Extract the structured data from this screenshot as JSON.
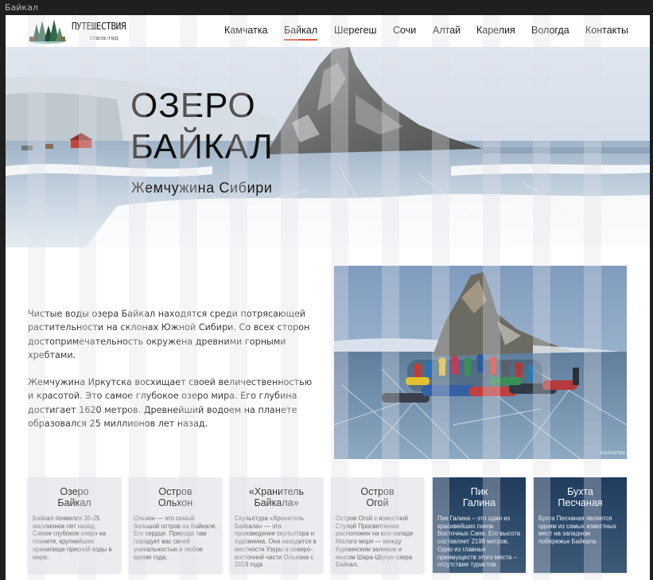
{
  "window": {
    "title": "Байкал"
  },
  "logo": {
    "title": "ПУТЕШЕСТВИЯ",
    "subtitle": "стиль-гид"
  },
  "nav": {
    "items": [
      {
        "label": "Камчатка"
      },
      {
        "label": "Байкал",
        "active": true
      },
      {
        "label": "Шерегеш"
      },
      {
        "label": "Сочи"
      },
      {
        "label": "Алтай"
      },
      {
        "label": "Карелия"
      },
      {
        "label": "Вологда"
      },
      {
        "label": "Контакты"
      }
    ],
    "active_color": "#e2553d"
  },
  "hero": {
    "title_line1": "ОЗЕРО",
    "title_line2": "БАЙКАЛ",
    "subtitle": "Жемчужина Сибири"
  },
  "intro": {
    "paragraph1": "Чистые воды озера Байкал находятся среди потрясающей растительности на склонах Южной Сибири. Со всех сторон достопримечательность окружена древними горными хребтами.",
    "paragraph2": "Жемчужина Иркутска восхищает своей величественностью и красотой. Это самое глубокое озеро мира. Его глубина достигает 1620 метров. Древнейший водоем на планете образовался 25 миллионов лет назад."
  },
  "photo": {
    "credit": "YOUSISTER"
  },
  "cards": [
    {
      "title_line1": "Озеро",
      "title_line2": "Байкал",
      "text": "Байкал появился 35-25 миллионов лет назад. Самое глубокое озеро на планете, крупнейшее хранилище пресной воды в мире.",
      "style": "light"
    },
    {
      "title_line1": "Остров",
      "title_line2": "Ольхон",
      "text": "Ольхон — это самый большой остров на Байкале. Его сердце. Природа там порадует вас своей уникальностью в любое время года.",
      "style": "light"
    },
    {
      "title_line1": "«Хранитель",
      "title_line2": "Байкала»",
      "text": "Скульптура «Хранитель Байкала» — это произведение скульптора и художника. Она находится в местности Узуры в северо-восточной части Ольхона с 2018 года",
      "style": "light"
    },
    {
      "title_line1": "Остров",
      "title_line2": "Огой",
      "text": "Остров Огой с известной Ступой Просветления расположен на юго-западе Малого моря — между Курминским заливом и мысом Шара-Шулун озера Байкал.",
      "style": "light"
    },
    {
      "title_line1": "Пик",
      "title_line2": "Галина",
      "text": "Пик Галина – это один из красивейших пиков Восточных Саян. Его высота составляет 2198 метров. Одно из главных преимуществ этого места – отсутствие туристов.",
      "style": "dark"
    },
    {
      "title_line1": "Бухта",
      "title_line2": "Песчаная",
      "text": "Бухта Песчаная является одним из самых известных мест на западном побережье Байкала.",
      "style": "dark"
    }
  ]
}
